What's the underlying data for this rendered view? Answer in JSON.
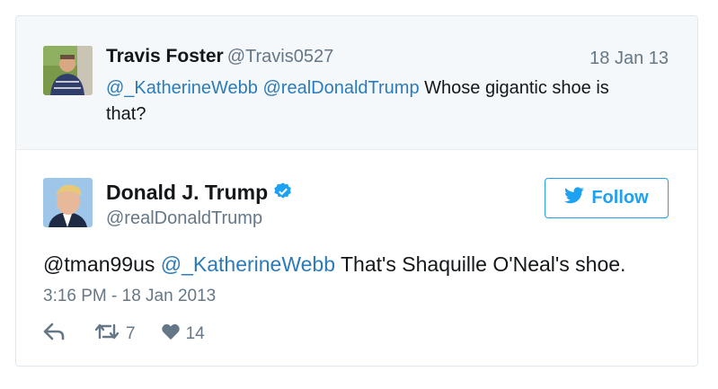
{
  "reply": {
    "name": "Travis Foster",
    "handle": "@Travis0527",
    "date": "18 Jan 13",
    "mention1": "@_KatherineWebb",
    "mention2": "@realDonaldTrump",
    "text": "Whose gigantic shoe is that?"
  },
  "tweet": {
    "name": "Donald J. Trump",
    "handle": "@realDonaldTrump",
    "follow_label": "Follow",
    "mention1": "@tman99us",
    "mention2": "@_KatherineWebb",
    "text": "That's Shaquille O'Neal's shoe.",
    "timestamp": "3:16 PM - 18 Jan 2013",
    "retweets": "7",
    "likes": "14"
  },
  "colors": {
    "link": "#2b7bb9",
    "accent": "#1da1f2",
    "muted": "#657786",
    "reply_bg": "#f5f8fa"
  }
}
